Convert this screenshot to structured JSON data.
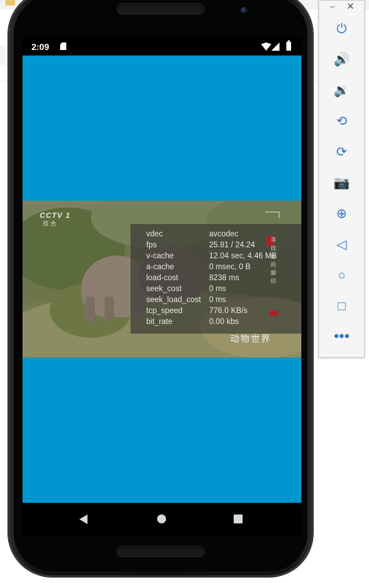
{
  "status_bar": {
    "time": "2:09"
  },
  "video": {
    "channel_logo": "CCTV 1",
    "channel_sub": "综合",
    "side_text": [
      "寻",
      "找",
      "象",
      "的",
      "脚",
      "印"
    ],
    "caption": "动物世界"
  },
  "debug_stats": [
    {
      "key": "vdec",
      "value": "avcodec"
    },
    {
      "key": "fps",
      "value": "25.81 / 24.24"
    },
    {
      "key": "v-cache",
      "value": "12.04 sec, 4.46 MB"
    },
    {
      "key": "a-cache",
      "value": "0 msec, 0 B"
    },
    {
      "key": "load-cost",
      "value": "8238 ms"
    },
    {
      "key": "seek_cost",
      "value": "0 ms"
    },
    {
      "key": "seek_load_cost",
      "value": "0 ms"
    },
    {
      "key": "tcp_speed",
      "value": "776.0 KB/s"
    },
    {
      "key": "bit_rate",
      "value": "0.00 kbs"
    }
  ],
  "emulator_toolbar": {
    "minimize": "–",
    "close": "✕",
    "buttons": [
      {
        "name": "power",
        "glyph": "⏻"
      },
      {
        "name": "volume-up",
        "glyph": "🔊"
      },
      {
        "name": "volume-down",
        "glyph": "🔉"
      },
      {
        "name": "rotate-left",
        "glyph": "⟲"
      },
      {
        "name": "rotate-right",
        "glyph": "⟳"
      },
      {
        "name": "screenshot",
        "glyph": "📷"
      },
      {
        "name": "zoom",
        "glyph": "⊕"
      },
      {
        "name": "back",
        "glyph": "◁"
      },
      {
        "name": "home",
        "glyph": "○"
      },
      {
        "name": "overview",
        "glyph": "□"
      },
      {
        "name": "more",
        "glyph": "•••"
      }
    ]
  },
  "colors": {
    "app_background": "#0096cf",
    "toolbar_icon": "#2f76c9"
  }
}
